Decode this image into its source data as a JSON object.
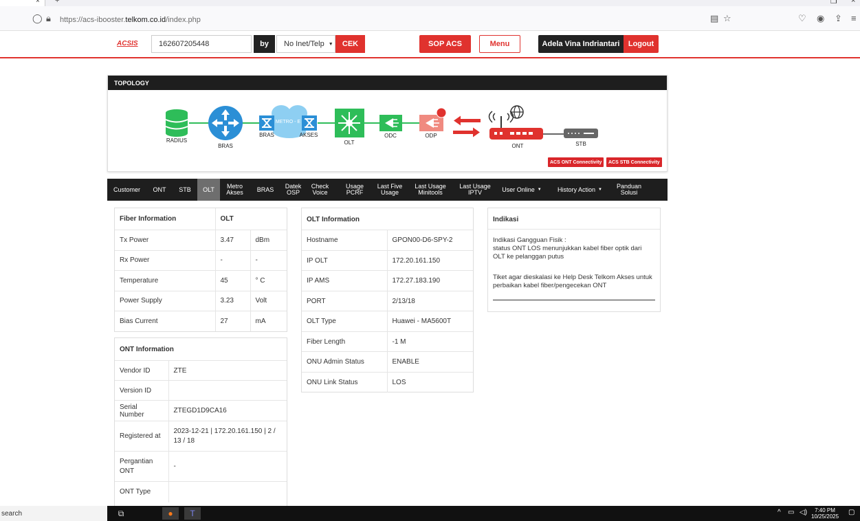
{
  "browser": {
    "url_prefix": "https://acs-ibooster.",
    "url_domain": "telkom.co.id",
    "url_path": "/index.php"
  },
  "header": {
    "logo": "ACSIS",
    "search_value": "162607205448",
    "by_label": "by",
    "search_type": "No Inet/Telp",
    "cek_label": "CEK",
    "sop_label": "SOP ACS",
    "menu_label": "Menu",
    "user_name": "Adela Vina Indriantari",
    "logout_label": "Logout"
  },
  "topology": {
    "title": "TOPOLOGY",
    "labels": {
      "radius": "RADIUS",
      "bras": "BRAS",
      "metro_e": "METRO - E",
      "bras2": "BRAS",
      "akses": "AKSES",
      "olt": "OLT",
      "odc": "ODC",
      "odp": "ODP",
      "ont": "ONT",
      "stb": "STB"
    },
    "odp_badge": "3",
    "acs_ont_btn": "ACS ONT Connectivity",
    "acs_stb_btn": "ACS STB Connectivity",
    "colors": {
      "green": "#2ebd59",
      "blue": "#2b8fd6",
      "red": "#e0322e",
      "pink": "#f08a80",
      "gray": "#666666"
    }
  },
  "nav": {
    "customer": "Customer",
    "ont": "ONT",
    "stb": "STB",
    "olt": "OLT",
    "metro_1": "Metro",
    "metro_2": "Akses",
    "bras": "BRAS",
    "datek_1": "Datek",
    "datek_2": "OSP",
    "check_1": "Check",
    "check_2": "Voice",
    "usage_1": "Usage",
    "usage_2": "PCRF",
    "lastfive_1": "Last Five",
    "lastfive_2": "Usage",
    "lastusage_1": "Last Usage",
    "lastusage_2": "Minitools",
    "lastiptv_1": "Last Usage",
    "lastiptv_2": "IPTV",
    "user_online": "User Online",
    "history_action": "History Action",
    "panduan_1": "Panduan",
    "panduan_2": "Solusi"
  },
  "fiber": {
    "header": "Fiber Information",
    "header_col": "OLT",
    "rows": [
      {
        "label": "Tx Power",
        "value": "3.47",
        "unit": "dBm"
      },
      {
        "label": "Rx Power",
        "value": "-",
        "unit": "-"
      },
      {
        "label": "Temperature",
        "value": "45",
        "unit": "° C"
      },
      {
        "label": "Power Supply",
        "value": "3.23",
        "unit": "Volt"
      },
      {
        "label": "Bias Current",
        "value": "27",
        "unit": "mA"
      }
    ]
  },
  "ont_info": {
    "header": "ONT Information",
    "rows": [
      {
        "label": "Vendor ID",
        "value": "ZTE"
      },
      {
        "label": "Version ID",
        "value": ""
      },
      {
        "label": "Serial Number",
        "value": "ZTEGD1D9CA16"
      },
      {
        "label": "Registered at",
        "value": "2023-12-21 | 172.20.161.150 | 2 / 13 / 18"
      },
      {
        "label": "Pergantian ONT",
        "value": "-"
      },
      {
        "label": "ONT Type",
        "value": ""
      }
    ]
  },
  "olt_info": {
    "header": "OLT Information",
    "rows": [
      {
        "label": "Hostname",
        "value": "GPON00-D6-SPY-2"
      },
      {
        "label": "IP OLT",
        "value": "172.20.161.150"
      },
      {
        "label": "IP AMS",
        "value": "172.27.183.190"
      },
      {
        "label": "PORT",
        "value": "2/13/18"
      },
      {
        "label": "OLT Type",
        "value": "Huawei - MA5600T"
      },
      {
        "label": "Fiber Length",
        "value": "-1 M"
      },
      {
        "label": "ONU Admin Status",
        "value": "ENABLE"
      },
      {
        "label": "ONU Link Status",
        "value": "LOS"
      }
    ]
  },
  "indikasi": {
    "header": "Indikasi",
    "line1": "Indikasi Gangguan Fisik :",
    "line2": "status ONT LOS menunjukkan kabel fiber optik dari OLT ke pelanggan putus",
    "line3": "Tiket agar dieskalasi ke Help Desk Telkom Akses untuk perbaikan kabel fiber/pengecekan ONT"
  },
  "taskbar": {
    "search": "search",
    "time": "7:40 PM",
    "date": "10/25/2025"
  }
}
